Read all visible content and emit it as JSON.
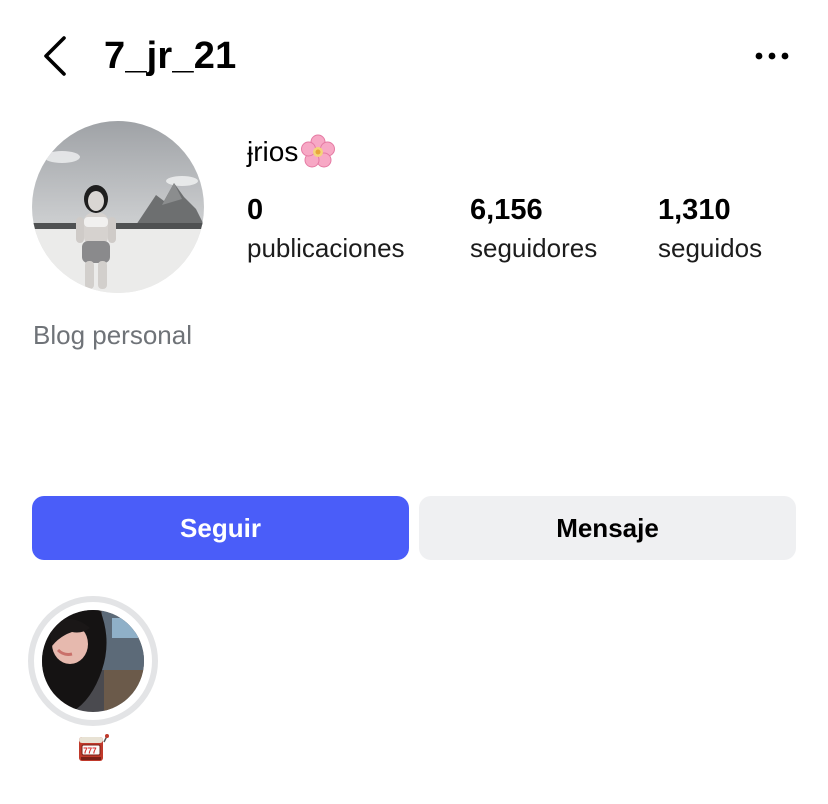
{
  "header": {
    "username": "7_jr_21",
    "back_icon": "chevron-left-icon",
    "more_icon": "more-horizontal-icon"
  },
  "profile": {
    "display_name": "ɉrios",
    "display_name_emoji": "cherry-blossom-icon",
    "category": "Blog personal"
  },
  "stats": [
    {
      "value": "0",
      "label": "publicaciones"
    },
    {
      "value": "6,156",
      "label": "seguidores"
    },
    {
      "value": "1,310",
      "label": "seguidos"
    }
  ],
  "actions": {
    "follow_label": "Seguir",
    "message_label": "Mensaje"
  },
  "highlights": [
    {
      "label_icon": "slot-machine-icon"
    }
  ],
  "colors": {
    "primary": "#4a5df9",
    "secondary_button": "#eff0f2",
    "muted_text": "#6f7378",
    "highlight_ring": "#e3e4e6"
  }
}
